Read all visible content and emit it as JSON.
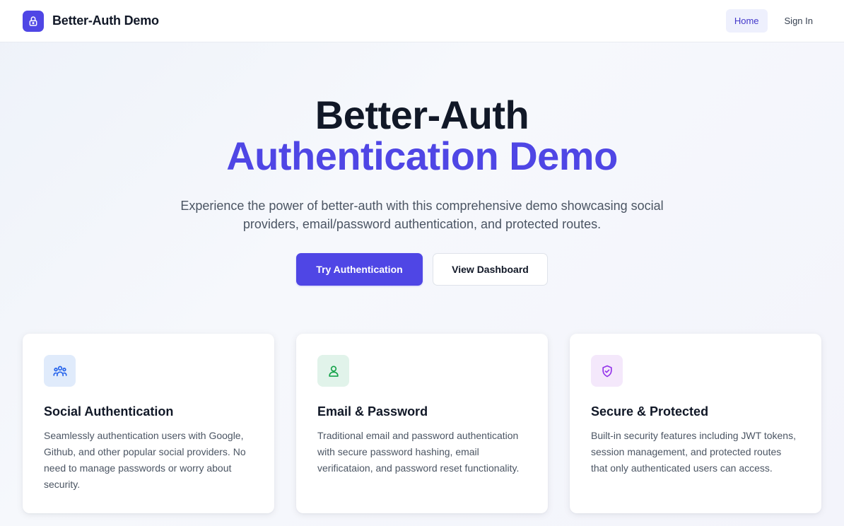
{
  "header": {
    "brand": "Better-Auth Demo",
    "nav": [
      {
        "label": "Home",
        "active": true
      },
      {
        "label": "Sign In",
        "active": false
      }
    ]
  },
  "hero": {
    "title_line1": "Better-Auth",
    "title_line2": "Authentication Demo",
    "subtitle": "Experience the power of better-auth with this comprehensive demo showcasing social providers, email/password authentication, and protected routes.",
    "primary_button": "Try Authentication",
    "secondary_button": "View Dashboard"
  },
  "features": [
    {
      "icon": "users-icon",
      "title": "Social Authentication",
      "description": "Seamlessly authentication users with Google, Github, and other popular social providers. No need to manage passwords or worry about security."
    },
    {
      "icon": "user-icon",
      "title": "Email & Password",
      "description": "Traditional email and password authentication with secure password hashing, email verificataion, and password reset functionality."
    },
    {
      "icon": "shield-check-icon",
      "title": "Secure & Protected",
      "description": "Built-in security features including JWT tokens, session management, and protected routes that only authenticated users can access."
    }
  ],
  "colors": {
    "brand": "#4f46e5",
    "social_icon_bg": "#e0ebfb",
    "social_icon": "#2563eb",
    "email_icon_bg": "#e1f3ea",
    "email_icon": "#16a34a",
    "secure_icon_bg": "#f4e8fb",
    "secure_icon": "#9333ea"
  }
}
